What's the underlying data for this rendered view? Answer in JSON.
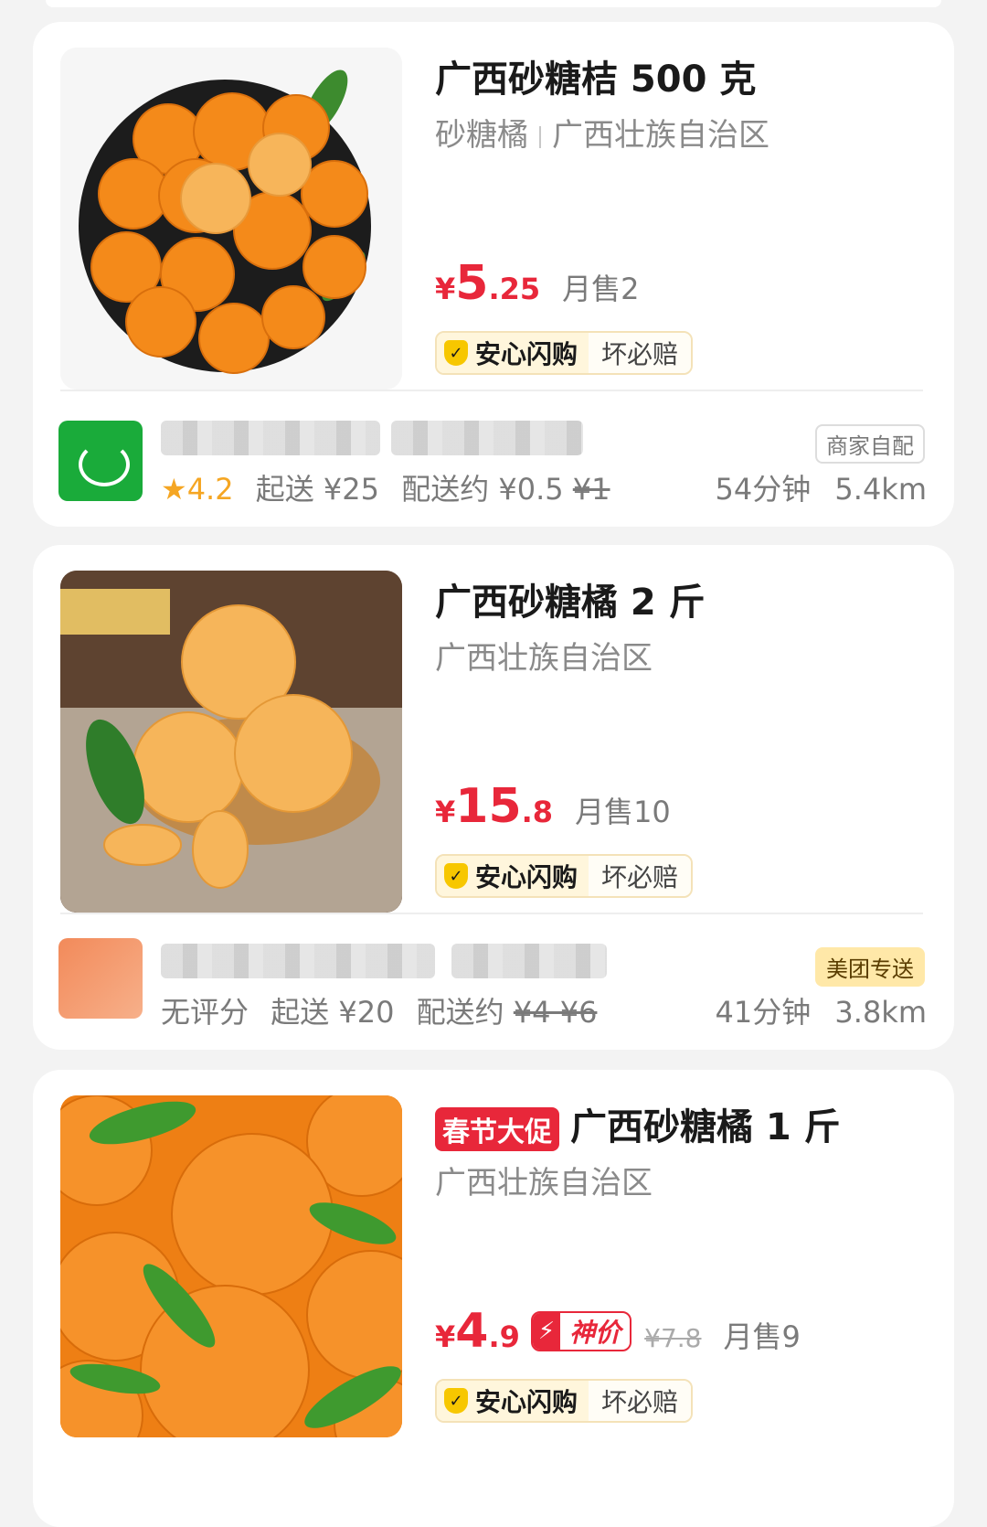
{
  "products": [
    {
      "title": "广西砂糖桔 500 克",
      "tags": [
        "砂糖橘",
        "广西壮族自治区"
      ],
      "price": {
        "yen": "¥",
        "int": "5",
        "dec": ".25"
      },
      "sold": "月售2",
      "assure": {
        "main": "安心闪购",
        "sub": "坏必赔"
      },
      "store": {
        "rating": "4.2",
        "min_order": "起送 ¥25",
        "delivery_fee": "配送约 ¥0.5",
        "delivery_fee_orig": "¥1",
        "time": "54分钟",
        "distance": "5.4km",
        "tag": "商家自配"
      }
    },
    {
      "title": "广西砂糖橘 2 斤",
      "tags": [
        "广西壮族自治区"
      ],
      "price": {
        "yen": "¥",
        "int": "15",
        "dec": ".8"
      },
      "sold": "月售10",
      "assure": {
        "main": "安心闪购",
        "sub": "坏必赔"
      },
      "store": {
        "rating": "无评分",
        "min_order": "起送 ¥20",
        "delivery_fee": "配送约",
        "delivery_fee_orig": "¥4 ¥6",
        "time": "41分钟",
        "distance": "3.8km",
        "tag": "美团专送"
      }
    },
    {
      "promo": "春节大促",
      "title": "广西砂糖橘 1 斤",
      "tags": [
        "广西壮族自治区"
      ],
      "price": {
        "yen": "¥",
        "int": "4",
        "dec": ".9"
      },
      "low_price": "神价",
      "orig_price": "¥7.8",
      "sold": "月售9",
      "assure": {
        "main": "安心闪购",
        "sub": "坏必赔"
      }
    }
  ],
  "icons": {
    "star": "star-icon",
    "shield": "shield-check-icon",
    "bolt": "lightning-icon"
  },
  "colors": {
    "price": "#e8273a",
    "rating": "#f5a623",
    "assure_bg": "#fff6dc",
    "shield": "#f7c700"
  }
}
